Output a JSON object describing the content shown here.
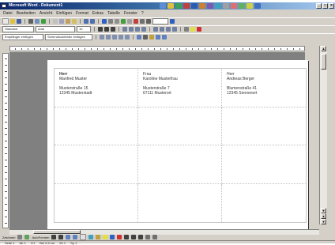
{
  "window": {
    "title": "Microsoft Word - Dokument1",
    "controls": [
      "_",
      "□",
      "×"
    ]
  },
  "menubar": {
    "items": [
      "Datei",
      "Bearbeiten",
      "Ansicht",
      "Einfügen",
      "Format",
      "Extras",
      "Tabelle",
      "Fenster",
      "?"
    ]
  },
  "toolbar_format": {
    "style_value": "Standard",
    "font_value": "Arial",
    "size_value": "10"
  },
  "toolbar_mail": {
    "recipients_label": "Empfänger einfügen",
    "mergefield_label": "Seriendruckfelder einfügen"
  },
  "labels": [
    {
      "salutation": "Herr",
      "name": "Manfred Muster",
      "street": "Musterstraße 15",
      "city": "12345 Musterstadt"
    },
    {
      "salutation": "Frau",
      "name": "Karoline Musterfrau",
      "street": "Musterstraße 7",
      "city": "67111 Musterort"
    },
    {
      "salutation": "Herr",
      "name": "Andreas Berger",
      "street": "Blumenstraße 41",
      "city": "12345 Sonnenort"
    }
  ],
  "drawbar": {
    "draw_label": "Zeichnen",
    "autoshapes_label": "AutoFormen"
  },
  "statusbar": {
    "page": "Seite 1",
    "section": "Ab 1",
    "page_of": "1/1",
    "position": "Bei 2,5 cm",
    "line": "Ze 1",
    "column": "Sp 1"
  }
}
